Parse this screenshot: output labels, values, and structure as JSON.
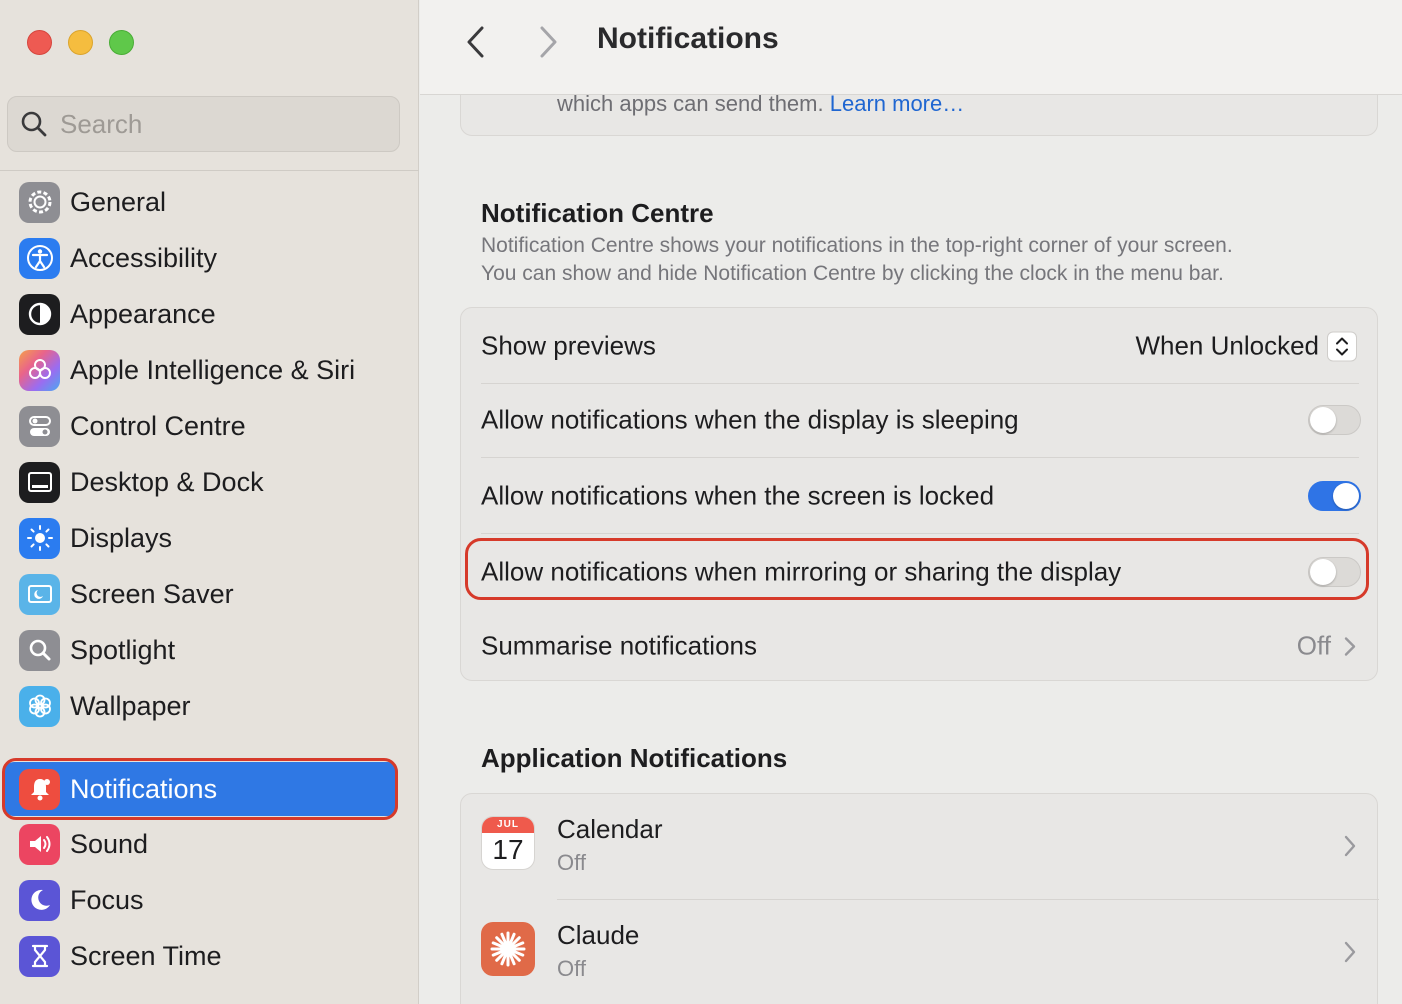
{
  "window": {
    "title": "Notifications"
  },
  "search": {
    "placeholder": "Search"
  },
  "sidebar": {
    "items": [
      {
        "label": "General",
        "icon": "gear-icon",
        "color": "#8e8e93"
      },
      {
        "label": "Accessibility",
        "icon": "accessibility-icon",
        "color": "#2b7cf0"
      },
      {
        "label": "Appearance",
        "icon": "appearance-icon",
        "color": "#1d1d1f"
      },
      {
        "label": "Apple Intelligence & Siri",
        "icon": "siri-icon",
        "color": "#e9648a"
      },
      {
        "label": "Control Centre",
        "icon": "control-centre-icon",
        "color": "#8e8e93"
      },
      {
        "label": "Desktop & Dock",
        "icon": "dock-icon",
        "color": "#1d1d1f"
      },
      {
        "label": "Displays",
        "icon": "displays-icon",
        "color": "#2b7cf0"
      },
      {
        "label": "Screen Saver",
        "icon": "screen-saver-icon",
        "color": "#5ab4e8"
      },
      {
        "label": "Spotlight",
        "icon": "spotlight-icon",
        "color": "#8e8e93"
      },
      {
        "label": "Wallpaper",
        "icon": "wallpaper-icon",
        "color": "#4ab0ea"
      },
      {
        "label": "Notifications",
        "icon": "notifications-bell-icon",
        "color": "#ee4d3f",
        "selected": true
      },
      {
        "label": "Sound",
        "icon": "sound-icon",
        "color": "#ec4561"
      },
      {
        "label": "Focus",
        "icon": "focus-moon-icon",
        "color": "#5b55d6"
      },
      {
        "label": "Screen Time",
        "icon": "screen-time-icon",
        "color": "#5b55d6"
      }
    ]
  },
  "intro": {
    "text": "which apps can send them.",
    "link": "Learn more…"
  },
  "notification_centre": {
    "title": "Notification Centre",
    "description_line1": "Notification Centre shows your notifications in the top-right corner of your screen.",
    "description_line2": "You can show and hide Notification Centre by clicking the clock in the menu bar.",
    "show_previews": {
      "label": "Show previews",
      "value": "When Unlocked"
    },
    "display_sleeping": {
      "label": "Allow notifications when the display is sleeping",
      "on": false
    },
    "screen_locked": {
      "label": "Allow notifications when the screen is locked",
      "on": true
    },
    "mirroring": {
      "label": "Allow notifications when mirroring or sharing the display",
      "on": false
    },
    "summarise": {
      "label": "Summarise notifications",
      "value": "Off"
    }
  },
  "app_notifications": {
    "title": "Application Notifications",
    "apps": [
      {
        "name": "Calendar",
        "status": "Off",
        "icon_month": "JUL",
        "icon_day": "17"
      },
      {
        "name": "Claude",
        "status": "Off"
      }
    ]
  },
  "colors": {
    "accent": "#2f78e4",
    "highlight": "#d63a2a",
    "link": "#1f66d1"
  }
}
